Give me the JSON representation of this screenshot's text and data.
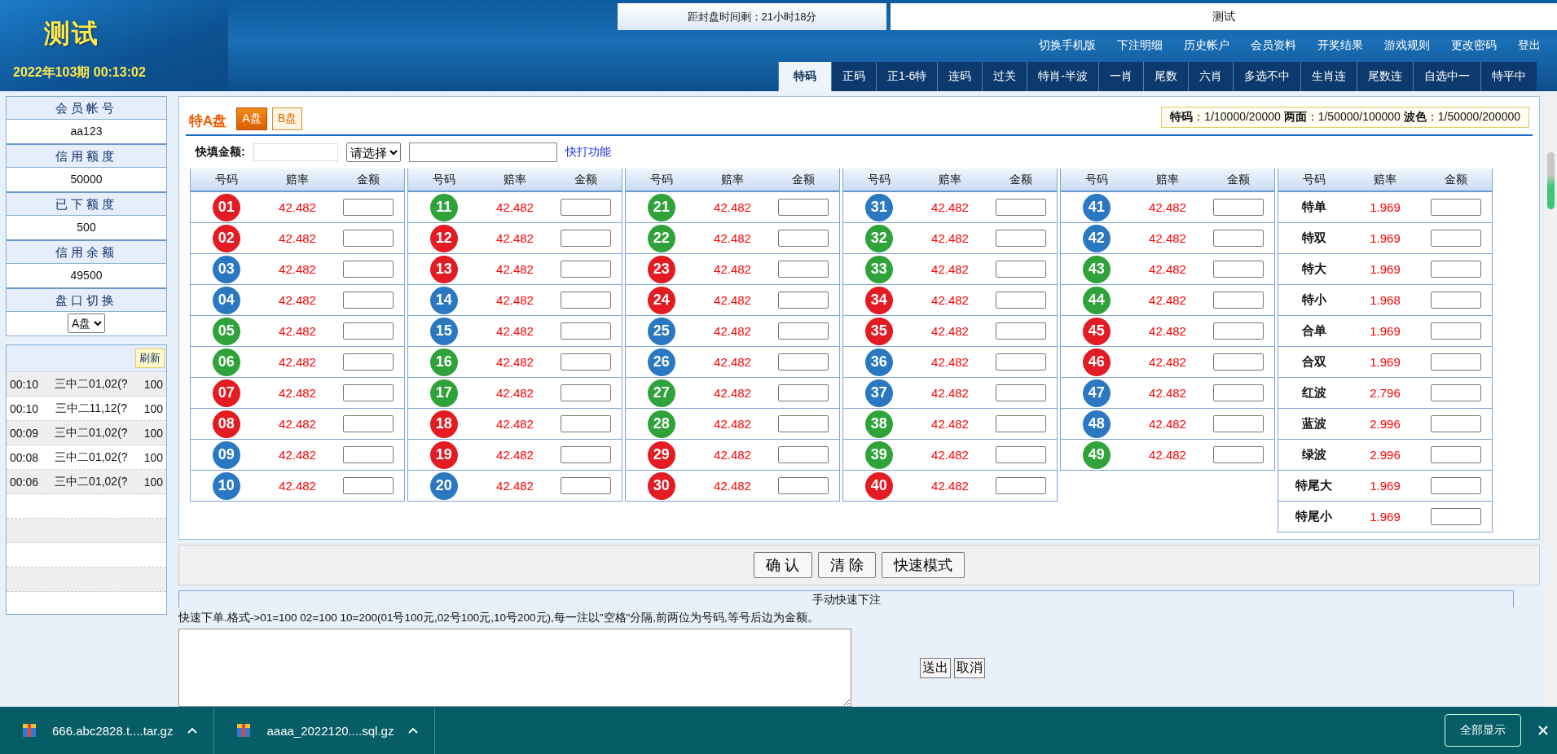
{
  "header": {
    "logo": "测试",
    "countdown": "距封盘时间剩：21小时18分",
    "center_title": "测试",
    "period": "2022年103期 00:13:02",
    "links": [
      "切换手机版",
      "下注明细",
      "历史帐户",
      "会员资料",
      "开奖结果",
      "游戏规则",
      "更改密码",
      "登出"
    ],
    "tabs": [
      {
        "label": "特码",
        "selected": true
      },
      {
        "label": "正码",
        "selected": false
      },
      {
        "label": "正1-6特",
        "selected": false
      },
      {
        "label": "连码",
        "selected": false
      },
      {
        "label": "过关",
        "selected": false
      },
      {
        "label": "特肖-半波",
        "selected": false
      },
      {
        "label": "一肖",
        "selected": false
      },
      {
        "label": "尾数",
        "selected": false
      },
      {
        "label": "六肖",
        "selected": false
      },
      {
        "label": "多选不中",
        "selected": false
      },
      {
        "label": "生肖连",
        "selected": false
      },
      {
        "label": "尾数连",
        "selected": false
      },
      {
        "label": "自选中一",
        "selected": false
      },
      {
        "label": "特平中",
        "selected": false
      }
    ]
  },
  "sidebar": {
    "info": [
      {
        "label": "会员帐号",
        "value": "aa123"
      },
      {
        "label": "信用额度",
        "value": "50000"
      },
      {
        "label": "已下额度",
        "value": "500"
      },
      {
        "label": "信用余额",
        "value": "49500"
      }
    ],
    "plate_label": "盘口切换",
    "plate_select": "A盘",
    "refresh": "刷新",
    "recent": [
      {
        "time": "00:10",
        "content": "三中二01,02(?",
        "amount": "100"
      },
      {
        "time": "00:10",
        "content": "三中二11,12(?",
        "amount": "100"
      },
      {
        "time": "00:09",
        "content": "三中二01,02(?",
        "amount": "100"
      },
      {
        "time": "00:08",
        "content": "三中二01,02(?",
        "amount": "100"
      },
      {
        "time": "00:06",
        "content": "三中二01,02(?",
        "amount": "100"
      }
    ]
  },
  "main": {
    "title": "特A盘",
    "plates": [
      {
        "label": "A盘",
        "selected": true
      },
      {
        "label": "B盘",
        "selected": false
      }
    ],
    "limits": "**特码**：1/10000/20000 **两面**：1/50000/100000 **波色**：1/50000/200000",
    "quick_fill_label": "快填金额:",
    "quick_select": "请选择",
    "quick_link": "快打功能",
    "tables": [
      {
        "headers": [
          "号码",
          "赔率",
          "金额"
        ],
        "rows": [
          {
            "kind": "ball",
            "number": "01",
            "color": "#e31b23",
            "odds": "42.482"
          },
          {
            "kind": "ball",
            "number": "02",
            "color": "#e31b23",
            "odds": "42.482"
          },
          {
            "kind": "ball",
            "number": "03",
            "color": "#2b78c2",
            "odds": "42.482"
          },
          {
            "kind": "ball",
            "number": "04",
            "color": "#2b78c2",
            "odds": "42.482"
          },
          {
            "kind": "ball",
            "number": "05",
            "color": "#2fa33a",
            "odds": "42.482"
          },
          {
            "kind": "ball",
            "number": "06",
            "color": "#2fa33a",
            "odds": "42.482"
          },
          {
            "kind": "ball",
            "number": "07",
            "color": "#e31b23",
            "odds": "42.482"
          },
          {
            "kind": "ball",
            "number": "08",
            "color": "#e31b23",
            "odds": "42.482"
          },
          {
            "kind": "ball",
            "number": "09",
            "color": "#2b78c2",
            "odds": "42.482"
          },
          {
            "kind": "ball",
            "number": "10",
            "color": "#2b78c2",
            "odds": "42.482"
          }
        ]
      },
      {
        "headers": [
          "号码",
          "赔率",
          "金额"
        ],
        "rows": [
          {
            "kind": "ball",
            "number": "11",
            "color": "#2fa33a",
            "odds": "42.482"
          },
          {
            "kind": "ball",
            "number": "12",
            "color": "#e31b23",
            "odds": "42.482"
          },
          {
            "kind": "ball",
            "number": "13",
            "color": "#e31b23",
            "odds": "42.482"
          },
          {
            "kind": "ball",
            "number": "14",
            "color": "#2b78c2",
            "odds": "42.482"
          },
          {
            "kind": "ball",
            "number": "15",
            "color": "#2b78c2",
            "odds": "42.482"
          },
          {
            "kind": "ball",
            "number": "16",
            "color": "#2fa33a",
            "odds": "42.482"
          },
          {
            "kind": "ball",
            "number": "17",
            "color": "#2fa33a",
            "odds": "42.482"
          },
          {
            "kind": "ball",
            "number": "18",
            "color": "#e31b23",
            "odds": "42.482"
          },
          {
            "kind": "ball",
            "number": "19",
            "color": "#e31b23",
            "odds": "42.482"
          },
          {
            "kind": "ball",
            "number": "20",
            "color": "#2b78c2",
            "odds": "42.482"
          }
        ]
      },
      {
        "headers": [
          "号码",
          "赔率",
          "金额"
        ],
        "rows": [
          {
            "kind": "ball",
            "number": "21",
            "color": "#2fa33a",
            "odds": "42.482"
          },
          {
            "kind": "ball",
            "number": "22",
            "color": "#2fa33a",
            "odds": "42.482"
          },
          {
            "kind": "ball",
            "number": "23",
            "color": "#e31b23",
            "odds": "42.482"
          },
          {
            "kind": "ball",
            "number": "24",
            "color": "#e31b23",
            "odds": "42.482"
          },
          {
            "kind": "ball",
            "number": "25",
            "color": "#2b78c2",
            "odds": "42.482"
          },
          {
            "kind": "ball",
            "number": "26",
            "color": "#2b78c2",
            "odds": "42.482"
          },
          {
            "kind": "ball",
            "number": "27",
            "color": "#2fa33a",
            "odds": "42.482"
          },
          {
            "kind": "ball",
            "number": "28",
            "color": "#2fa33a",
            "odds": "42.482"
          },
          {
            "kind": "ball",
            "number": "29",
            "color": "#e31b23",
            "odds": "42.482"
          },
          {
            "kind": "ball",
            "number": "30",
            "color": "#e31b23",
            "odds": "42.482"
          }
        ]
      },
      {
        "headers": [
          "号码",
          "赔率",
          "金额"
        ],
        "rows": [
          {
            "kind": "ball",
            "number": "31",
            "color": "#2b78c2",
            "odds": "42.482"
          },
          {
            "kind": "ball",
            "number": "32",
            "color": "#2fa33a",
            "odds": "42.482"
          },
          {
            "kind": "ball",
            "number": "33",
            "color": "#2fa33a",
            "odds": "42.482"
          },
          {
            "kind": "ball",
            "number": "34",
            "color": "#e31b23",
            "odds": "42.482"
          },
          {
            "kind": "ball",
            "number": "35",
            "color": "#e31b23",
            "odds": "42.482"
          },
          {
            "kind": "ball",
            "number": "36",
            "color": "#2b78c2",
            "odds": "42.482"
          },
          {
            "kind": "ball",
            "number": "37",
            "color": "#2b78c2",
            "odds": "42.482"
          },
          {
            "kind": "ball",
            "number": "38",
            "color": "#2fa33a",
            "odds": "42.482"
          },
          {
            "kind": "ball",
            "number": "39",
            "color": "#2fa33a",
            "odds": "42.482"
          },
          {
            "kind": "ball",
            "number": "40",
            "color": "#e31b23",
            "odds": "42.482"
          }
        ]
      },
      {
        "headers": [
          "号码",
          "赔率",
          "金额"
        ],
        "rows": [
          {
            "kind": "ball",
            "number": "41",
            "color": "#2b78c2",
            "odds": "42.482"
          },
          {
            "kind": "ball",
            "number": "42",
            "color": "#2b78c2",
            "odds": "42.482"
          },
          {
            "kind": "ball",
            "number": "43",
            "color": "#2fa33a",
            "odds": "42.482"
          },
          {
            "kind": "ball",
            "number": "44",
            "color": "#2fa33a",
            "odds": "42.482"
          },
          {
            "kind": "ball",
            "number": "45",
            "color": "#e31b23",
            "odds": "42.482"
          },
          {
            "kind": "ball",
            "number": "46",
            "color": "#e31b23",
            "odds": "42.482"
          },
          {
            "kind": "ball",
            "number": "47",
            "color": "#2b78c2",
            "odds": "42.482"
          },
          {
            "kind": "ball",
            "number": "48",
            "color": "#2b78c2",
            "odds": "42.482"
          },
          {
            "kind": "ball",
            "number": "49",
            "color": "#2fa33a",
            "odds": "42.482"
          }
        ]
      },
      {
        "headers": [
          "号码",
          "赔率",
          "金额"
        ],
        "rows": [
          {
            "kind": "label",
            "label": "特单",
            "odds": "1.969"
          },
          {
            "kind": "label",
            "label": "特双",
            "odds": "1.969"
          },
          {
            "kind": "label",
            "label": "特大",
            "odds": "1.969"
          },
          {
            "kind": "label",
            "label": "特小",
            "odds": "1.968"
          },
          {
            "kind": "label",
            "label": "合单",
            "odds": "1.969"
          },
          {
            "kind": "label",
            "label": "合双",
            "odds": "1.969"
          },
          {
            "kind": "label",
            "label": "红波",
            "odds": "2.796"
          },
          {
            "kind": "label",
            "label": "蓝波",
            "odds": "2.996"
          },
          {
            "kind": "label",
            "label": "绿波",
            "odds": "2.996"
          },
          {
            "kind": "label",
            "label": "特尾大",
            "odds": "1.969"
          },
          {
            "kind": "label",
            "label": "特尾小",
            "odds": "1.969"
          }
        ]
      }
    ],
    "actions": [
      "确 认",
      "清 除",
      "快速模式"
    ],
    "manual": {
      "title": "手动快速下注",
      "hint": "快速下单.格式->01=100 02=100 10=200(01号100元,02号100元,10号200元),每一注以\"空格\"分隔,前两位为号码,等号后边为金额。",
      "buttons": [
        "送出",
        "取消"
      ]
    }
  },
  "downloads": {
    "files": [
      {
        "name": "666.abc2828.t....tar.gz"
      },
      {
        "name": "aaaa_2022120....sql.gz"
      }
    ],
    "show_all": "全部显示"
  }
}
